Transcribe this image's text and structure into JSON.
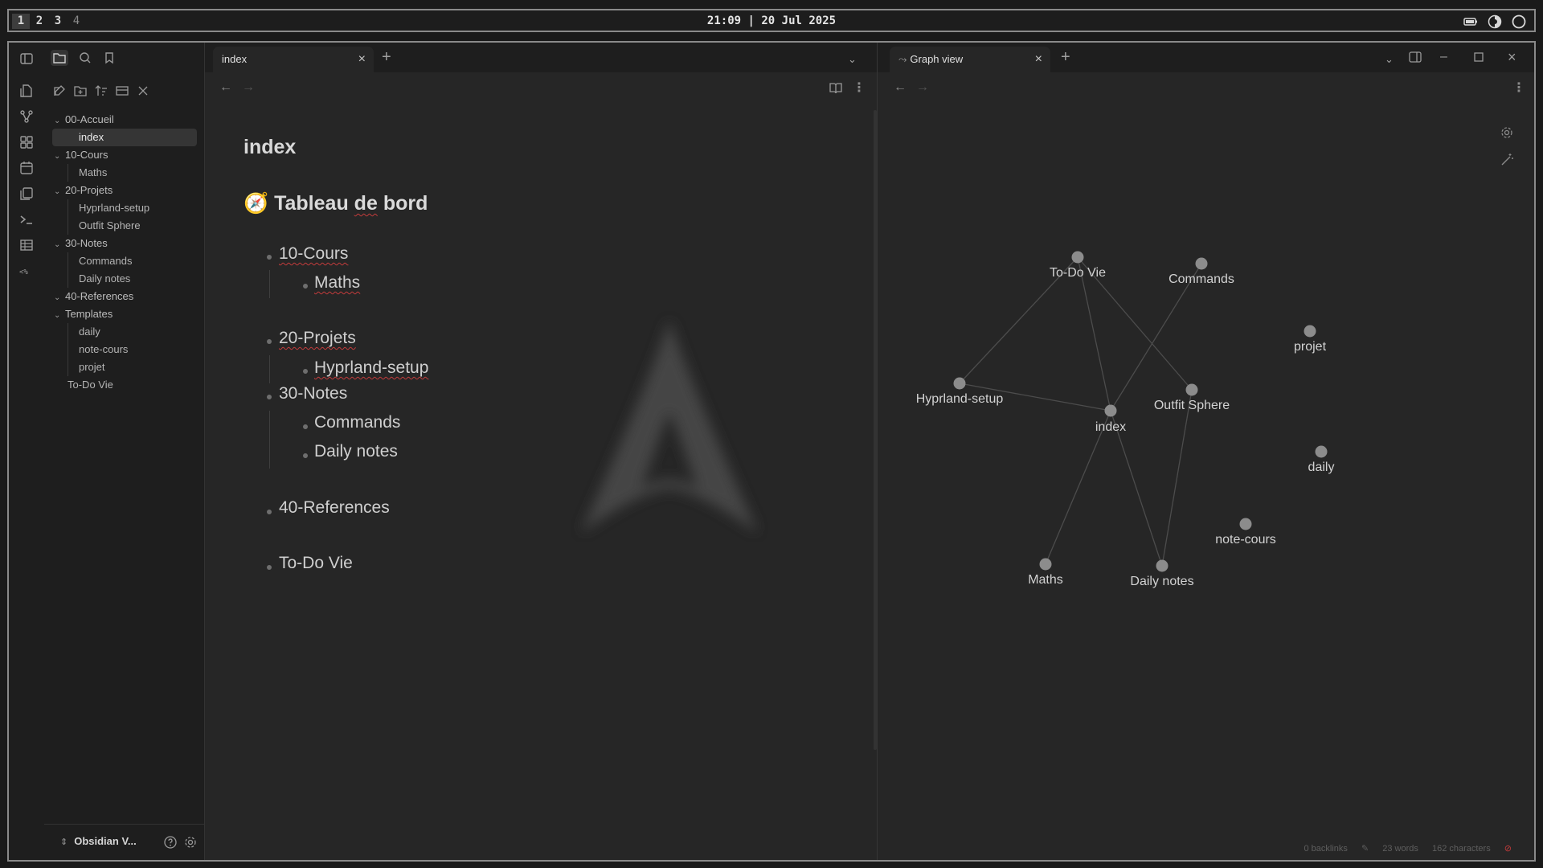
{
  "topbar": {
    "workspaces": [
      "1",
      "2",
      "3",
      "4"
    ],
    "clock": "21:09 | 20 Jul 2025"
  },
  "sidebar": {
    "tree": [
      {
        "label": "00-Accueil",
        "type": "folder"
      },
      {
        "label": "index",
        "type": "file",
        "active": true
      },
      {
        "label": "10-Cours",
        "type": "folder"
      },
      {
        "label": "Maths",
        "type": "file"
      },
      {
        "label": "20-Projets",
        "type": "folder"
      },
      {
        "label": "Hyprland-setup",
        "type": "file"
      },
      {
        "label": "Outfit Sphere",
        "type": "file"
      },
      {
        "label": "30-Notes",
        "type": "folder"
      },
      {
        "label": "Commands",
        "type": "file"
      },
      {
        "label": "Daily notes",
        "type": "file"
      },
      {
        "label": "40-References",
        "type": "folder"
      },
      {
        "label": "Templates",
        "type": "folder"
      },
      {
        "label": "daily",
        "type": "file"
      },
      {
        "label": "note-cours",
        "type": "file"
      },
      {
        "label": "projet",
        "type": "file"
      },
      {
        "label": "To-Do Vie",
        "type": "file"
      }
    ],
    "vault_name": "Obsidian V..."
  },
  "editor": {
    "tab_label": "index",
    "title": "index",
    "heading_emoji": "🧭",
    "heading_word1": "Tableau",
    "heading_word2": "de",
    "heading_word3": "bord",
    "list": [
      {
        "label": "10-Cours",
        "children": [
          "Maths"
        ]
      },
      {
        "label": "20-Projets",
        "children": [
          "Hyprland-setup"
        ]
      },
      {
        "label": "30-Notes",
        "children": [
          "Commands",
          "Daily notes"
        ]
      },
      {
        "label": "40-References",
        "children": []
      },
      {
        "label": "To-Do Vie",
        "children": []
      }
    ]
  },
  "graph": {
    "tab_label": "Graph view",
    "nodes": [
      "To-Do Vie",
      "Commands",
      "projet",
      "Hyprland-setup",
      "Outfit Sphere",
      "index",
      "daily",
      "note-cours",
      "Maths",
      "Daily notes"
    ]
  },
  "status": {
    "backlinks": "0 backlinks",
    "words": "23 words",
    "characters": "162 characters"
  }
}
